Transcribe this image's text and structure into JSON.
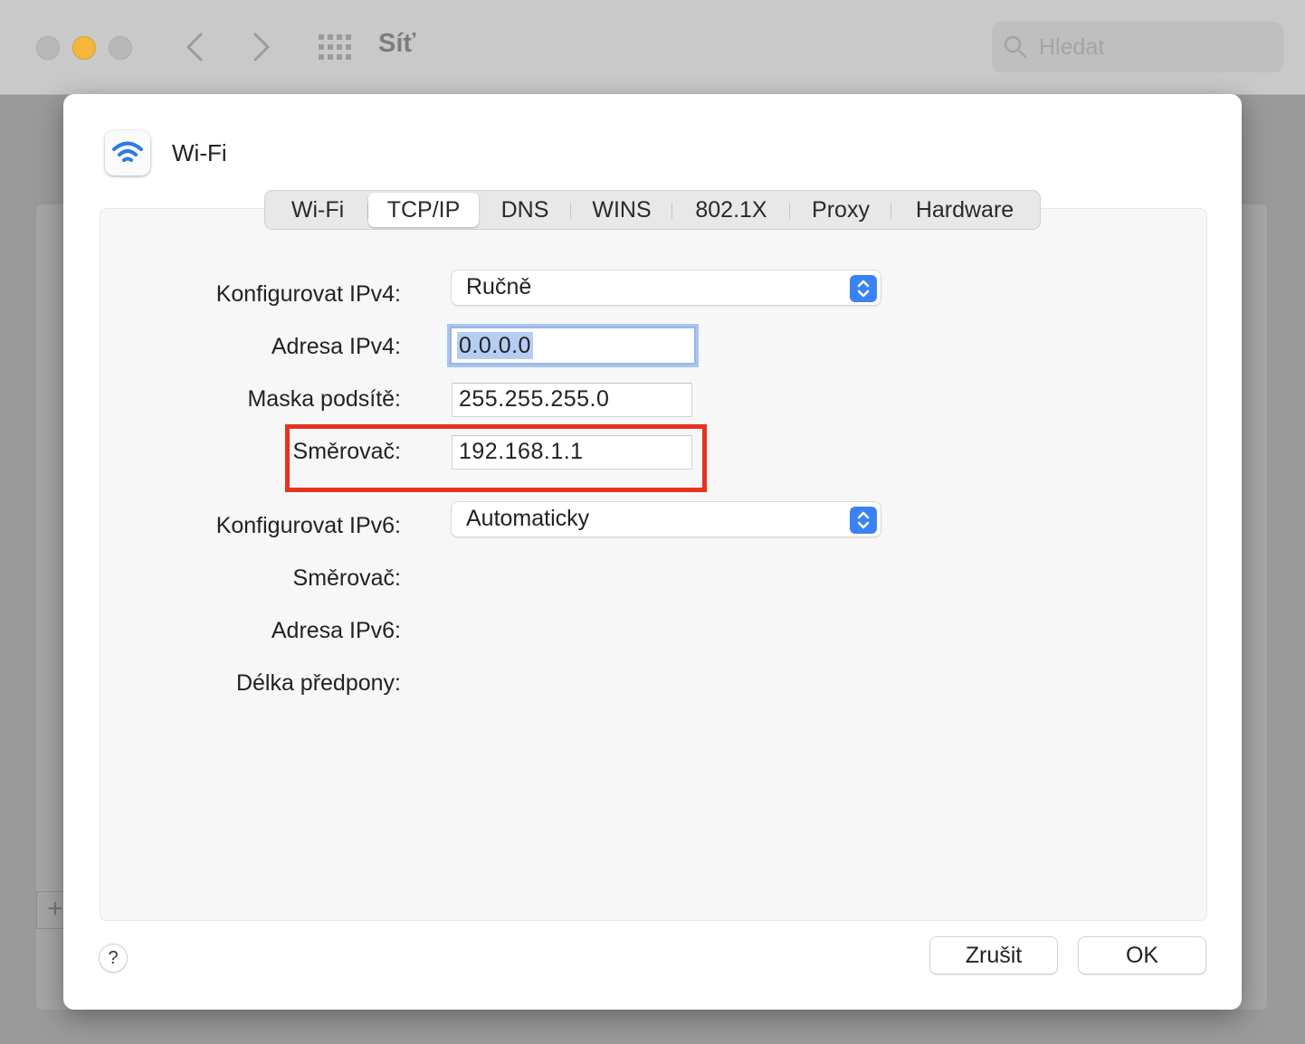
{
  "window": {
    "title": "Síť",
    "search_placeholder": "Hledat"
  },
  "sheet": {
    "service_name": "Wi-Fi",
    "tabs": [
      {
        "label": "Wi-Fi",
        "active": false
      },
      {
        "label": "TCP/IP",
        "active": true
      },
      {
        "label": "DNS",
        "active": false
      },
      {
        "label": "WINS",
        "active": false
      },
      {
        "label": "802.1X",
        "active": false
      },
      {
        "label": "Proxy",
        "active": false
      },
      {
        "label": "Hardware",
        "active": false
      }
    ],
    "ipv4": {
      "configure_label": "Konfigurovat IPv4:",
      "configure_value": "Ručně",
      "address_label": "Adresa IPv4:",
      "address_value": "0.0.0.0",
      "subnet_label": "Maska podsítě:",
      "subnet_value": "255.255.255.0",
      "router_label": "Směrovač:",
      "router_value": "192.168.1.1"
    },
    "ipv6": {
      "configure_label": "Konfigurovat IPv6:",
      "configure_value": "Automaticky",
      "router_label": "Směrovač:",
      "address_label": "Adresa IPv6:",
      "prefix_label": "Délka předpony:"
    },
    "buttons": {
      "help": "?",
      "cancel": "Zrušit",
      "ok": "OK"
    }
  },
  "colors": {
    "accent": "#3b82f6",
    "highlight": "#e8321f",
    "selection": "#b5cdf3"
  }
}
